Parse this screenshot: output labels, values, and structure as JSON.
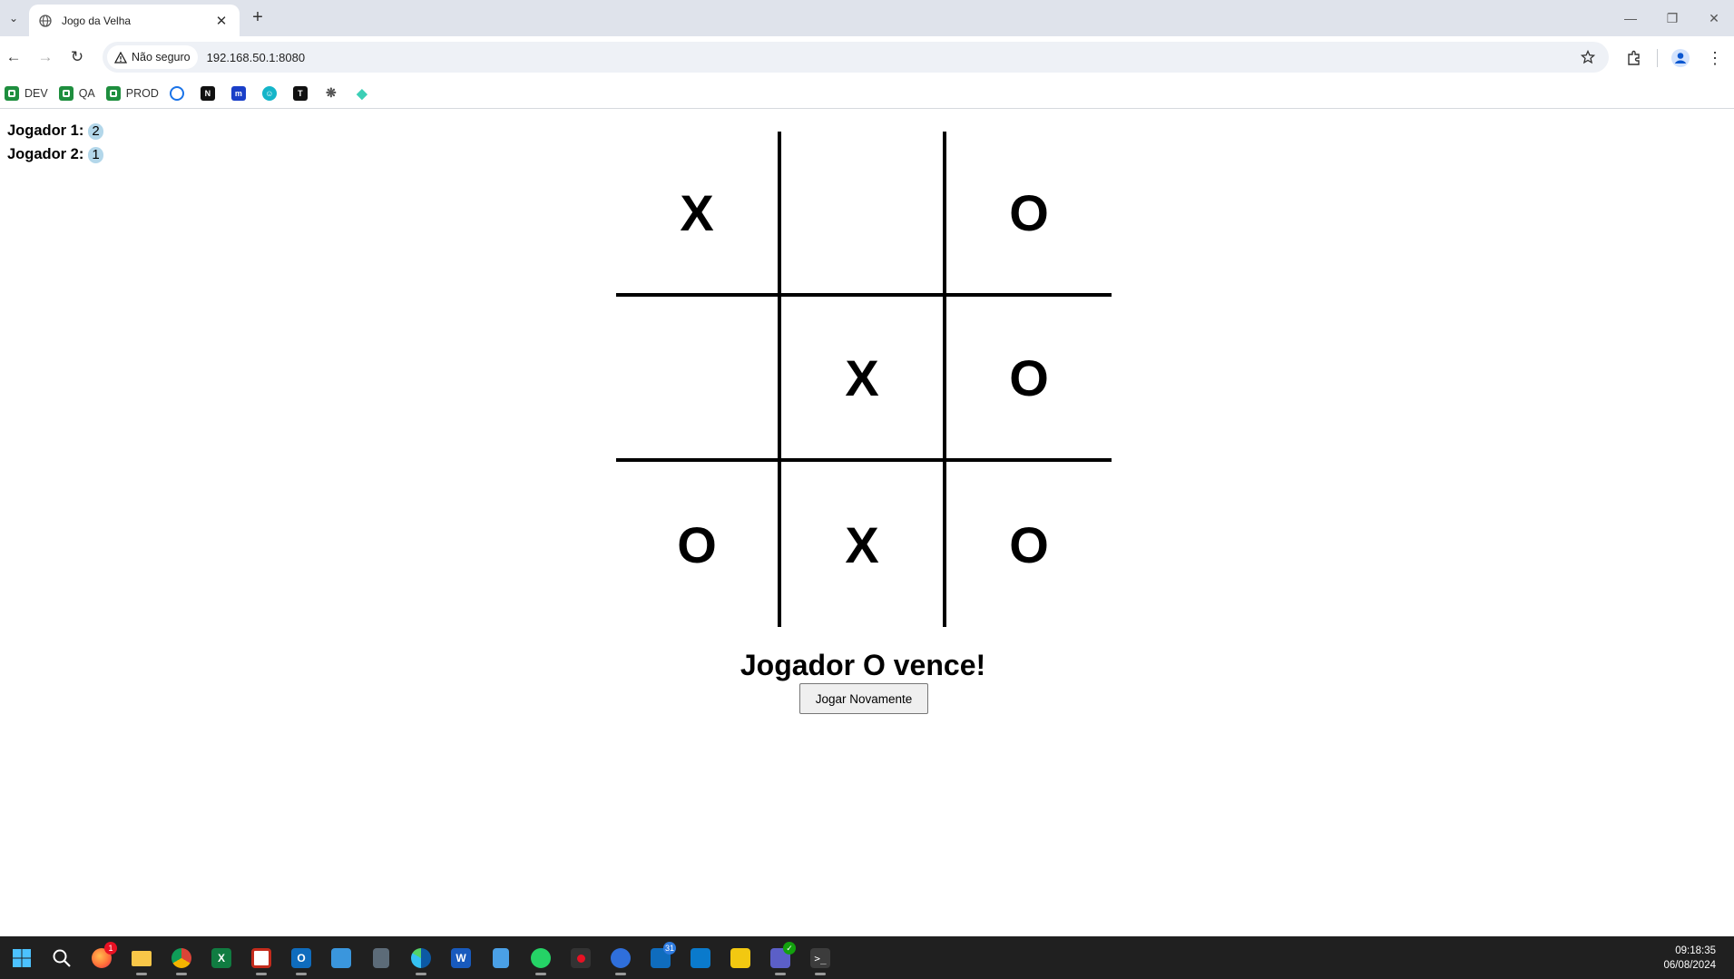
{
  "browser": {
    "tab": {
      "title": "Jogo da Velha"
    },
    "security_label": "Não seguro",
    "url": "192.168.50.1:8080",
    "bookmarks": [
      {
        "label": "DEV",
        "icon": "green-square-icon",
        "color": "#1e8e3e"
      },
      {
        "label": "QA",
        "icon": "green-square-icon",
        "color": "#1e8e3e"
      },
      {
        "label": "PROD",
        "icon": "green-square-icon",
        "color": "#1e8e3e"
      },
      {
        "label": "",
        "icon": "swirl-icon",
        "color": "#1a73e8"
      },
      {
        "label": "",
        "icon": "nm-icon",
        "color": "#111111"
      },
      {
        "label": "",
        "icon": "m-icon",
        "color": "#1a3fc8"
      },
      {
        "label": "",
        "icon": "face-icon",
        "color": "#15b5c9"
      },
      {
        "label": "",
        "icon": "t-icon",
        "color": "#111111"
      },
      {
        "label": "",
        "icon": "openai-icon",
        "color": "#555555"
      },
      {
        "label": "",
        "icon": "diamond-icon",
        "color": "#3ccfb6"
      }
    ]
  },
  "scoreboard": {
    "player1": {
      "label": "Jogador 1:",
      "score": "2"
    },
    "player2": {
      "label": "Jogador 2:",
      "score": "1"
    }
  },
  "board": {
    "cells": [
      "X",
      "",
      "O",
      "",
      "X",
      "O",
      "O",
      "X",
      "O"
    ]
  },
  "result_text": "Jogador O vence!",
  "replay_button": "Jogar Novamente",
  "taskbar": {
    "time": "09:18:35",
    "date": "06/08/2024",
    "badges": {
      "firefox": "1",
      "outlook_calendar": "31"
    }
  }
}
